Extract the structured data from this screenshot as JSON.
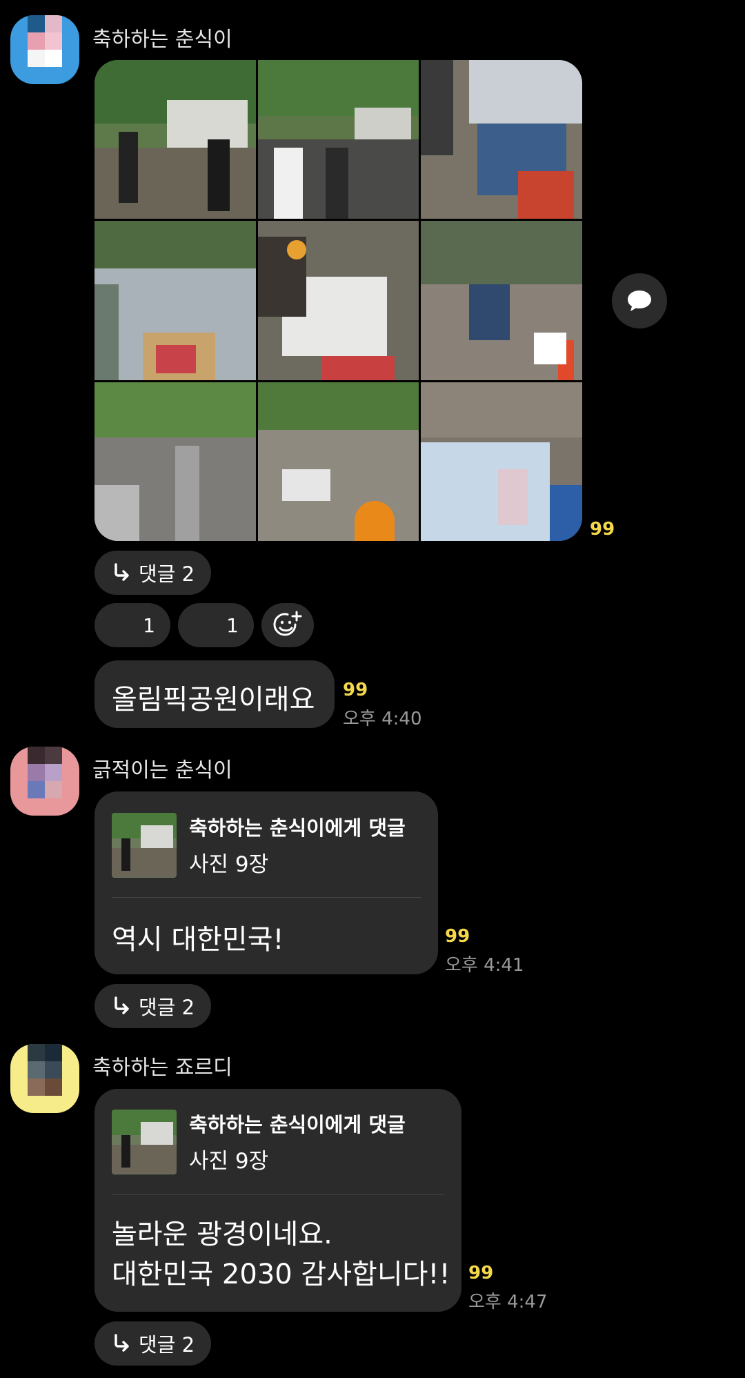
{
  "messages": [
    {
      "sender": "축하하는 춘식이",
      "photo_count_badge": "99",
      "reply_label": "댓글 2",
      "reactions": [
        {
          "count": "1"
        },
        {
          "count": "1"
        }
      ],
      "text": "올림픽공원이래요",
      "unread": "99",
      "time": "오후 4:40"
    },
    {
      "sender": "긁적이는 춘식이",
      "quote_title": "축하하는 춘식이에게 댓글",
      "quote_sub": "사진 9장",
      "text": "역시 대한민국!",
      "unread": "99",
      "time": "오후 4:41",
      "reply_label": "댓글 2"
    },
    {
      "sender": "축하하는 죠르디",
      "quote_title": "축하하는 춘식이에게 댓글",
      "quote_sub": "사진 9장",
      "text_line1": "놀라운 광경이네요.",
      "text_line2": "대한민국 2030 감사합니다!!",
      "unread": "99",
      "time": "오후 4:47",
      "reply_label": "댓글 2"
    }
  ],
  "icons": {
    "reply": "reply-arrow-icon",
    "add_reaction": "add-emoji-icon",
    "share": "speech-bubble-icon"
  },
  "colors": {
    "background": "#000000",
    "bubble": "#2b2b2b",
    "unread": "#f5d94a",
    "time": "#9a9a9a",
    "avatar1": "#3d9be0",
    "avatar2": "#e8989a",
    "avatar3": "#f7ec8a"
  }
}
